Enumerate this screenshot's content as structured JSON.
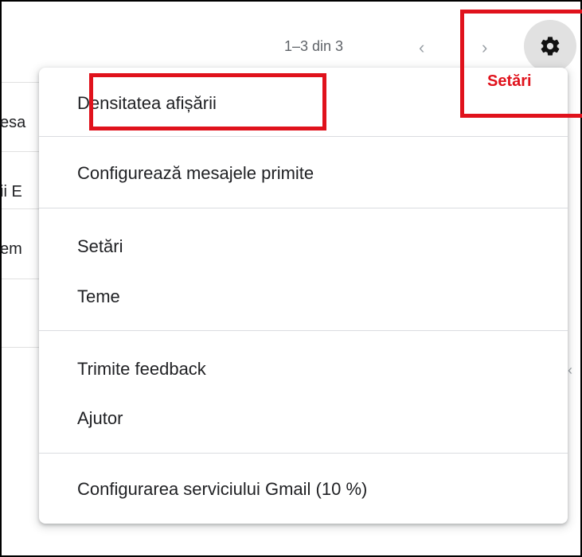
{
  "toolbar": {
    "pagination": "1–3 din 3",
    "prev_icon": "chevron-left-icon",
    "next_icon": "chevron-right-icon",
    "settings_icon": "gear-icon"
  },
  "annotation": {
    "settings_label": "Setări",
    "color": "#e0121c"
  },
  "background_rows": [
    "esa",
    "ii E",
    "em"
  ],
  "menu": {
    "items": [
      {
        "label": "Densitatea afișării"
      },
      {
        "label": "Configurează mesajele primite"
      },
      {
        "label": "Setări"
      },
      {
        "label": "Teme"
      },
      {
        "label": "Trimite feedback"
      },
      {
        "label": "Ajutor"
      },
      {
        "label": "Configurarea serviciului Gmail (10 %)"
      }
    ]
  }
}
